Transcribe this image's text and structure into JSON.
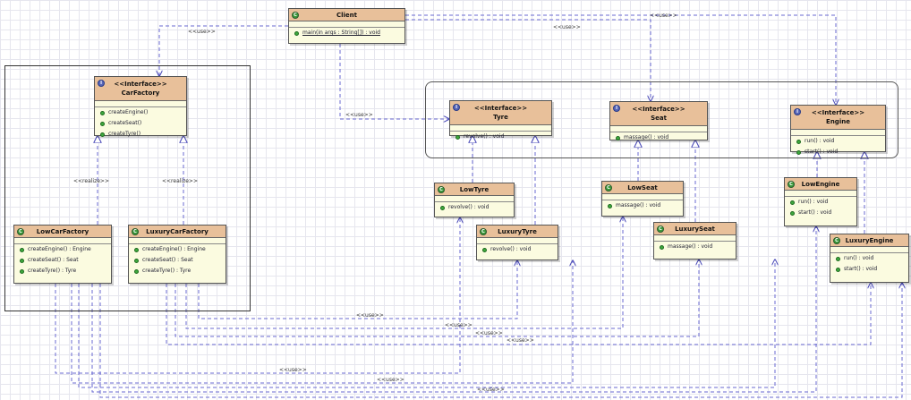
{
  "diagram": {
    "classes": {
      "client": {
        "kind": "C",
        "name": "Client",
        "ops": [
          {
            "text": "main(in args : String[]) : void",
            "static": true
          }
        ]
      },
      "carfactory": {
        "kind": "I",
        "stereo": "<<Interface>>",
        "name": "CarFactory",
        "ops": [
          {
            "text": "createEngine()"
          },
          {
            "text": "createSeat()"
          },
          {
            "text": "createTyre()"
          }
        ]
      },
      "lowcarfactory": {
        "kind": "C",
        "name": "LowCarFactory",
        "ops": [
          {
            "text": "createEngine() : Engine"
          },
          {
            "text": "createSeat() : Seat"
          },
          {
            "text": "createTyre() : Tyre"
          }
        ]
      },
      "luxurycarfactory": {
        "kind": "C",
        "name": "LuxuryCarFactory",
        "ops": [
          {
            "text": "createEngine() : Engine"
          },
          {
            "text": "createSeat() : Seat"
          },
          {
            "text": "createTyre() : Tyre"
          }
        ]
      },
      "tyre": {
        "kind": "I",
        "stereo": "<<Interface>>",
        "name": "Tyre",
        "ops": [
          {
            "text": "revolve() : void"
          }
        ]
      },
      "seat": {
        "kind": "I",
        "stereo": "<<Interface>>",
        "name": "Seat",
        "ops": [
          {
            "text": "massage() : void"
          }
        ]
      },
      "engine": {
        "kind": "I",
        "stereo": "<<Interface>>",
        "name": "Engine",
        "ops": [
          {
            "text": "run() : void"
          },
          {
            "text": "start() : void"
          }
        ]
      },
      "lowtyre": {
        "kind": "C",
        "name": "LowTyre",
        "ops": [
          {
            "text": "revolve() : void"
          }
        ]
      },
      "luxurytyre": {
        "kind": "C",
        "name": "LuxuryTyre",
        "ops": [
          {
            "text": "revolve() : void"
          }
        ]
      },
      "lowseat": {
        "kind": "C",
        "name": "LowSeat",
        "ops": [
          {
            "text": "massage() : void"
          }
        ]
      },
      "luxuryseat": {
        "kind": "C",
        "name": "LuxurySeat",
        "ops": [
          {
            "text": "massage() : void"
          }
        ]
      },
      "lowengine": {
        "kind": "C",
        "name": "LowEngine",
        "ops": [
          {
            "text": "run() : void"
          },
          {
            "text": "start() : void"
          }
        ]
      },
      "luxuryengine": {
        "kind": "C",
        "name": "LuxuryEngine",
        "ops": [
          {
            "text": "run() : void"
          },
          {
            "text": "start() : void"
          }
        ]
      }
    },
    "relations": {
      "use_label": "<<use>>",
      "realize_label": "<<realize>>"
    },
    "colors": {
      "header": "#e8c09a",
      "body": "#fbfbe0",
      "dependency_line": "#6a6ad0",
      "realization_line": "#6a6ad0"
    }
  }
}
